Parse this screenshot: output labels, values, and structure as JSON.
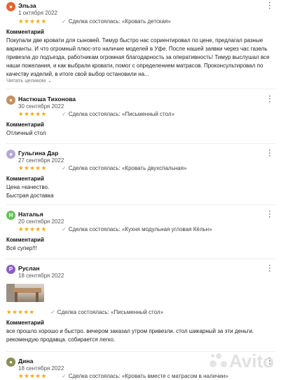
{
  "labels": {
    "comment_heading": "Комментарий",
    "show_more": "Читать целиком",
    "deal_prefix": "Сделка состоялась:"
  },
  "colors": {
    "star": "#f7a600"
  },
  "watermark": "Avito",
  "reviews": [
    {
      "name": "Эльза",
      "date": "1 октября 2022",
      "stars": 5,
      "deal": "«Кровать детская»",
      "avatar_color": "#e7632b",
      "avatar_letter": "",
      "comment": "Покупали две кровати для сыновей. Тимур быстро нас сориентировал по цене, предлагал разные варианты. И что огромный плюс-это наличие моделей в Уфе. После нашей заявки через час газель привезла до подъезда, работникам огромная благодарность за оперативность! Тимур выслушал все наши пожелания, и как выбрали кровати, помог с определением матрасов. Проконсультировал по качеству изделий, в итоге свой выбор остановили на...",
      "show_more": true
    },
    {
      "name": "Настюша Тихонова",
      "date": "30 сентября 2022",
      "stars": 5,
      "deal": "«Письменный стол»",
      "avatar_color": "#c59060",
      "avatar_letter": "",
      "comment": "Отличный стол"
    },
    {
      "name": "Гульгина Дар",
      "date": "27 сентября 2022",
      "stars": 5,
      "deal": "«Кровать двухспальная»",
      "avatar_color": "#b7a9d6",
      "avatar_letter": "",
      "comment": "Цена =качество.\nБыстрая доставка"
    },
    {
      "name": "Наталья",
      "date": "20 сентября 2022",
      "stars": 5,
      "deal": "«Кухня модульная угловая Кёльн»",
      "avatar_color": "#63c157",
      "avatar_letter": "Н",
      "comment": "Всё супер!!!"
    },
    {
      "name": "Руслан",
      "date": "18 сентября 2022",
      "stars": 5,
      "deal": "«Письменный стол»",
      "avatar_color": "#8a5bc8",
      "avatar_letter": "Р",
      "has_photo": true,
      "comment": "все прошло хорошо и быстро. вечером заказал утром привезли. стол шикарный за эти деньги. рекомендую продавца. собирается легко."
    },
    {
      "name": "Дина",
      "date": "18 сентября 2022",
      "stars": 5,
      "deal": "«Кровать вместе с матрасом в наличии»",
      "avatar_color": "#8a8f52",
      "avatar_letter": ""
    }
  ]
}
